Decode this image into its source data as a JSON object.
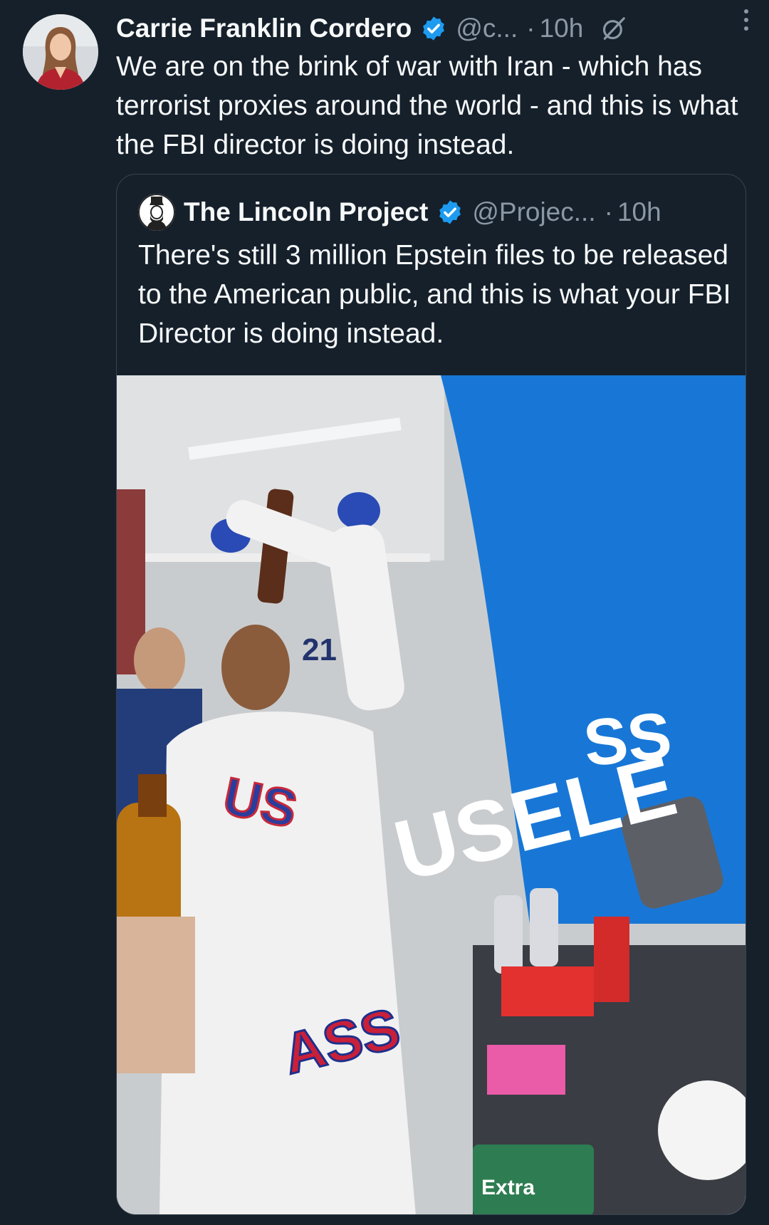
{
  "tweet": {
    "author_name": "Carrie Franklin Cordero",
    "handle": "@c...",
    "separator": "·",
    "time": "10h",
    "text": "We are on the brink of war with Iran - which has terrorist proxies around the world - and this is what the FBI director is doing instead.",
    "icons": {
      "verified": "verified-badge-icon",
      "grok": "grok-icon",
      "more": "more-vertical-icon"
    }
  },
  "quote": {
    "author_name": "The Lincoln Project",
    "handle": "@Projec...",
    "separator": "·",
    "time": "10h",
    "text": "There's still 3 million Epstein files to be released to the American public, and this is what your FBI Director is doing instead.",
    "media": {
      "overlay_words": [
        "USELE",
        "SS",
        "ASS"
      ],
      "shirt_text": "US",
      "jersey_number": "21",
      "gum_label": "Extra"
    }
  },
  "colors": {
    "background": "#15202b",
    "text": "#f7f9f9",
    "muted": "#8b98a5",
    "border": "#38444d",
    "verified": "#1d9bf0",
    "media_blue": "#1877d6"
  }
}
